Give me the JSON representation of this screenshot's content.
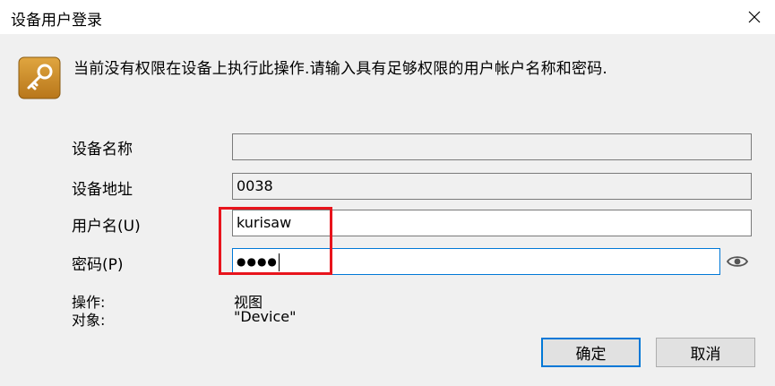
{
  "window": {
    "title": "设备用户登录"
  },
  "icons": {
    "close": "close-icon",
    "key": "key-icon",
    "eye": "eye-icon"
  },
  "message": "当前没有权限在设备上执行此操作.请输入具有足够权限的用户帐户名称和密码.",
  "form": {
    "device_name": {
      "label": "设备名称",
      "value": ""
    },
    "device_address": {
      "label": "设备地址",
      "value": "0038"
    },
    "username": {
      "label": "用户名(U)",
      "value": "kurisaw"
    },
    "password": {
      "label": "密码(P)",
      "masked_value": "●●●●"
    }
  },
  "operation": {
    "op_label": "操作:",
    "op_value": "视图",
    "target_label": "对象:",
    "target_value": "\"Device\""
  },
  "buttons": {
    "ok": "确定",
    "cancel": "取消"
  },
  "colors": {
    "highlight_box": "#e8141c",
    "focus_border": "#0078d7",
    "key_icon_bg": "#c98a1c"
  }
}
